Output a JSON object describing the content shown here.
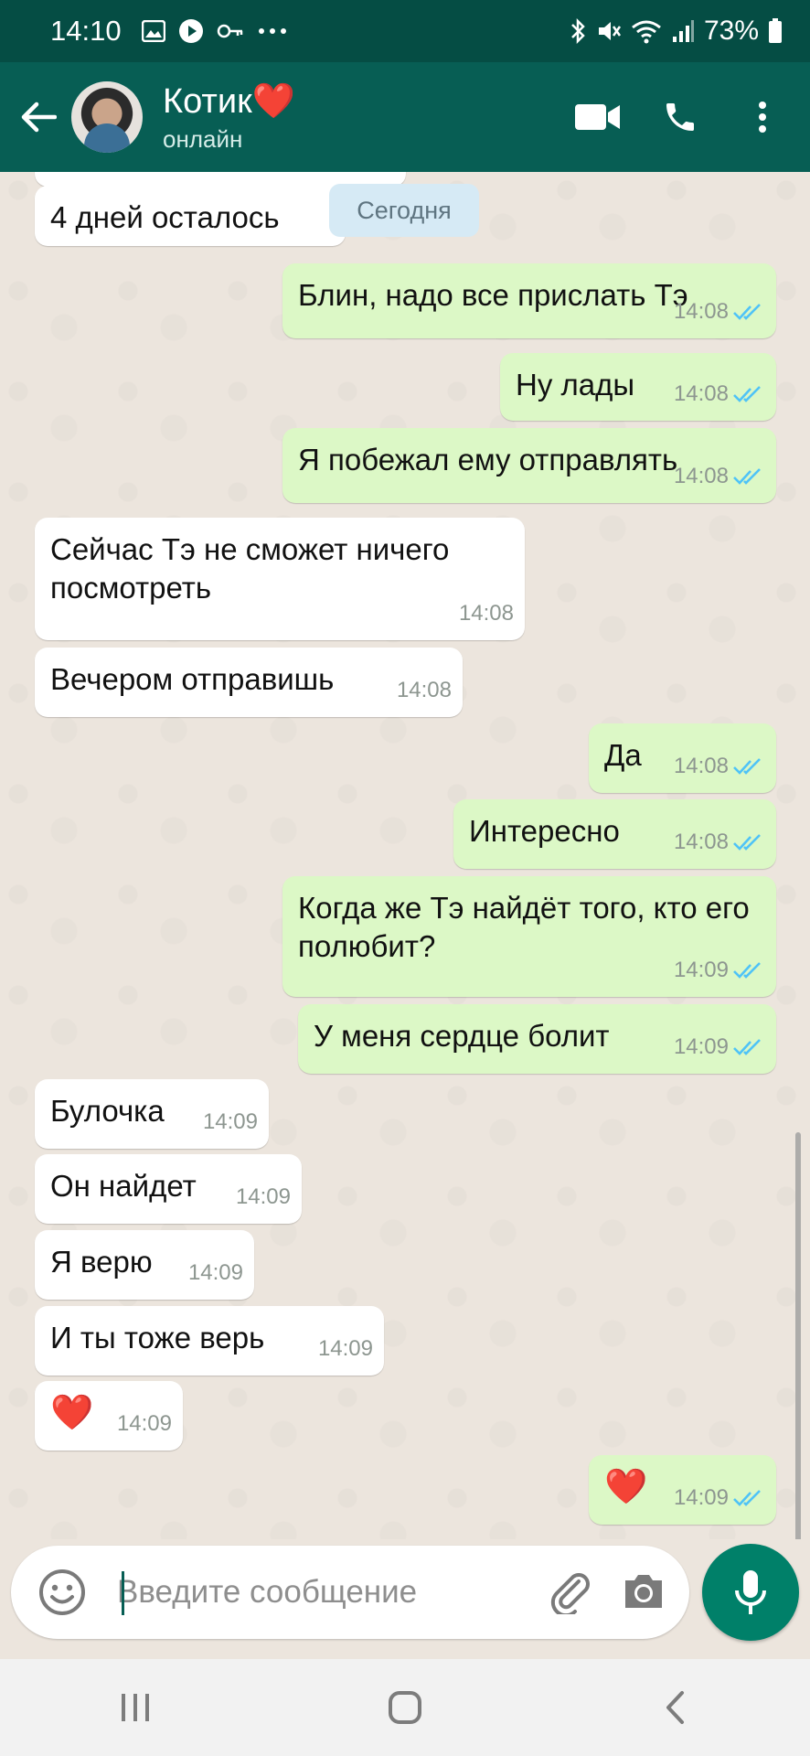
{
  "status_bar": {
    "time": "14:10",
    "battery": "73%"
  },
  "header": {
    "contact_name": "Котик",
    "contact_heart": "❤️",
    "status": "онлайн"
  },
  "date_chip": "Сегодня",
  "messages": [
    {
      "dir": "in",
      "text": "4 дней осталось",
      "time": ""
    },
    {
      "dir": "out",
      "text": "Блин, надо все прислать Тэ",
      "time": "14:08",
      "read": true
    },
    {
      "dir": "out",
      "text": "Ну лады",
      "time": "14:08",
      "read": true
    },
    {
      "dir": "out",
      "text": "Я побежал ему отправлять",
      "time": "14:08",
      "read": true
    },
    {
      "dir": "in",
      "text": "Сейчас Тэ не сможет ничего посмотреть",
      "time": "14:08"
    },
    {
      "dir": "in",
      "text": "Вечером отправишь",
      "time": "14:08"
    },
    {
      "dir": "out",
      "text": "Да",
      "time": "14:08",
      "read": true
    },
    {
      "dir": "out",
      "text": "Интересно",
      "time": "14:08",
      "read": true
    },
    {
      "dir": "out",
      "text": "Когда же Тэ найдёт того, кто его полюбит?",
      "time": "14:09",
      "read": true
    },
    {
      "dir": "out",
      "text": "У меня сердце болит",
      "time": "14:09",
      "read": true
    },
    {
      "dir": "in",
      "text": "Булочка",
      "time": "14:09"
    },
    {
      "dir": "in",
      "text": "Он найдет",
      "time": "14:09"
    },
    {
      "dir": "in",
      "text": "Я верю",
      "time": "14:09"
    },
    {
      "dir": "in",
      "text": "И ты тоже верь",
      "time": "14:09"
    },
    {
      "dir": "in",
      "text": "❤️",
      "time": "14:09"
    },
    {
      "dir": "out",
      "text": "❤️",
      "time": "14:09",
      "read": true
    }
  ],
  "input": {
    "placeholder": "Введите сообщение"
  },
  "colors": {
    "header": "#075e54",
    "status_bar": "#054d44",
    "outgoing": "#dcf8c6",
    "incoming": "#ffffff",
    "read_ticks": "#4fc3f7",
    "fab": "#008069"
  },
  "icons": [
    "back-arrow-icon",
    "video-call-icon",
    "phone-icon",
    "more-vert-icon",
    "emoji-icon",
    "attach-icon",
    "camera-icon",
    "mic-icon",
    "recents-icon",
    "home-icon",
    "nav-back-icon"
  ]
}
